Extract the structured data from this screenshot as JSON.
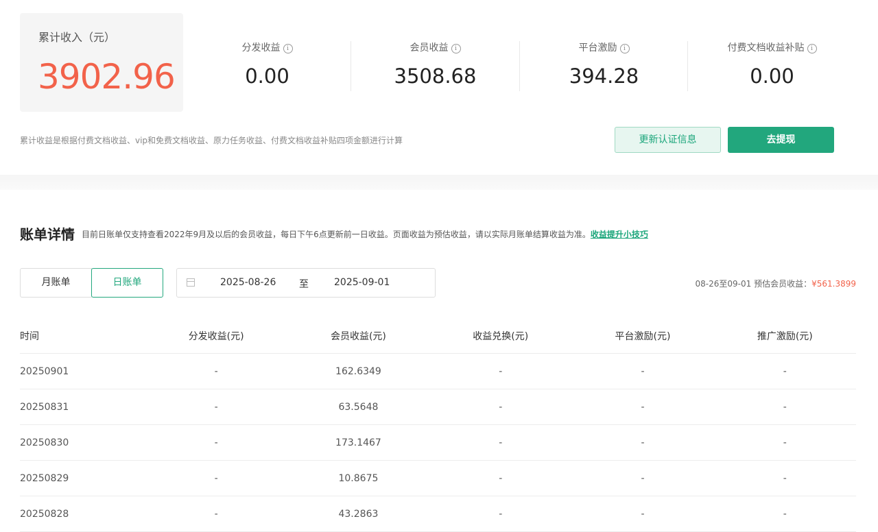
{
  "summary": {
    "total_label": "累计收入（元）",
    "total_value": "3902.96",
    "stats": [
      {
        "label": "分发收益",
        "value": "0.00"
      },
      {
        "label": "会员收益",
        "value": "3508.68"
      },
      {
        "label": "平台激励",
        "value": "394.28"
      },
      {
        "label": "付费文档收益补贴",
        "value": "0.00"
      }
    ],
    "info_glyph": "i",
    "note": "累计收益是根据付费文档收益、vip和免费文档收益、原力任务收益、付费文档收益补贴四项金额进行计算",
    "verify_button": "更新认证信息",
    "withdraw_button": "去提现"
  },
  "bill": {
    "title": "账单详情",
    "desc": "目前日账单仅支持查看2022年9月及以后的会员收益，每日下午6点更新前一日收益。页面收益为预估收益，请以实际月账单结算收益为准。",
    "tips_link": "收益提升小技巧",
    "tabs": {
      "month": "月账单",
      "day": "日账单"
    },
    "range": {
      "start": "2025-08-26",
      "sep": "至",
      "end": "2025-09-01"
    },
    "estimate_label": "08-26至09-01 预估会员收益：",
    "estimate_value": "¥561.3899",
    "columns": [
      "时间",
      "分发收益(元)",
      "会员收益(元)",
      "收益兑换(元)",
      "平台激励(元)",
      "推广激励(元)"
    ],
    "rows": [
      [
        "20250901",
        "-",
        "162.6349",
        "-",
        "-",
        "-"
      ],
      [
        "20250831",
        "-",
        "63.5648",
        "-",
        "-",
        "-"
      ],
      [
        "20250830",
        "-",
        "173.1467",
        "-",
        "-",
        "-"
      ],
      [
        "20250829",
        "-",
        "10.8675",
        "-",
        "-",
        "-"
      ],
      [
        "20250828",
        "-",
        "43.2863",
        "-",
        "-",
        "-"
      ]
    ]
  },
  "colors": {
    "accent": "#22a77d",
    "highlight": "#f2624a"
  }
}
